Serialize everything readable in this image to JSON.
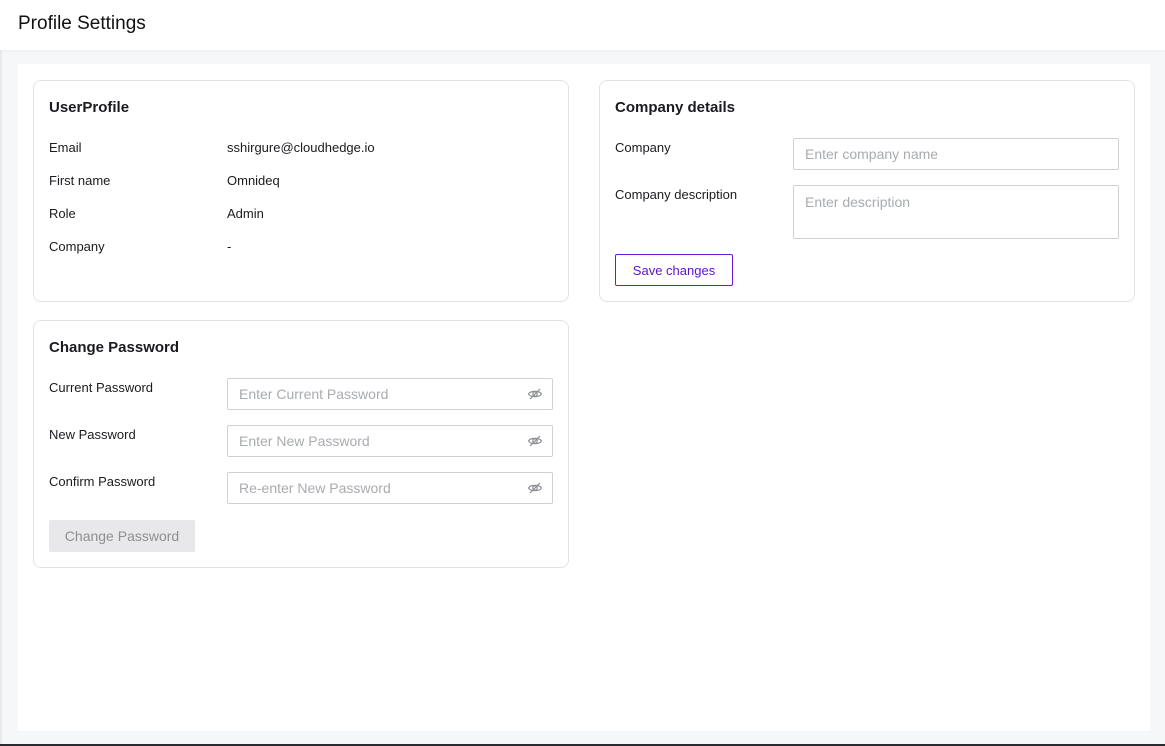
{
  "header": {
    "title": "Profile Settings"
  },
  "user_profile": {
    "title": "UserProfile",
    "rows": [
      {
        "label": "Email",
        "value": "sshirgure@cloudhedge.io"
      },
      {
        "label": "First name",
        "value": "Omnideq"
      },
      {
        "label": "Role",
        "value": "Admin"
      },
      {
        "label": "Company",
        "value": "-"
      }
    ]
  },
  "company_details": {
    "title": "Company details",
    "company_label": "Company",
    "company_placeholder": "Enter company name",
    "description_label": "Company description",
    "description_placeholder": "Enter description",
    "save_label": "Save changes"
  },
  "change_password": {
    "title": "Change Password",
    "current_label": "Current Password",
    "current_placeholder": "Enter Current Password",
    "new_label": "New Password",
    "new_placeholder": "Enter New Password",
    "confirm_label": "Confirm Password",
    "confirm_placeholder": "Re-enter New Password",
    "submit_label": "Change Password"
  },
  "icons": {
    "password_toggle": "eye-off-icon"
  },
  "colors": {
    "accent": "#5b13c7",
    "border": "#e2e3e6",
    "disabled_bg": "#e8e8ea"
  }
}
